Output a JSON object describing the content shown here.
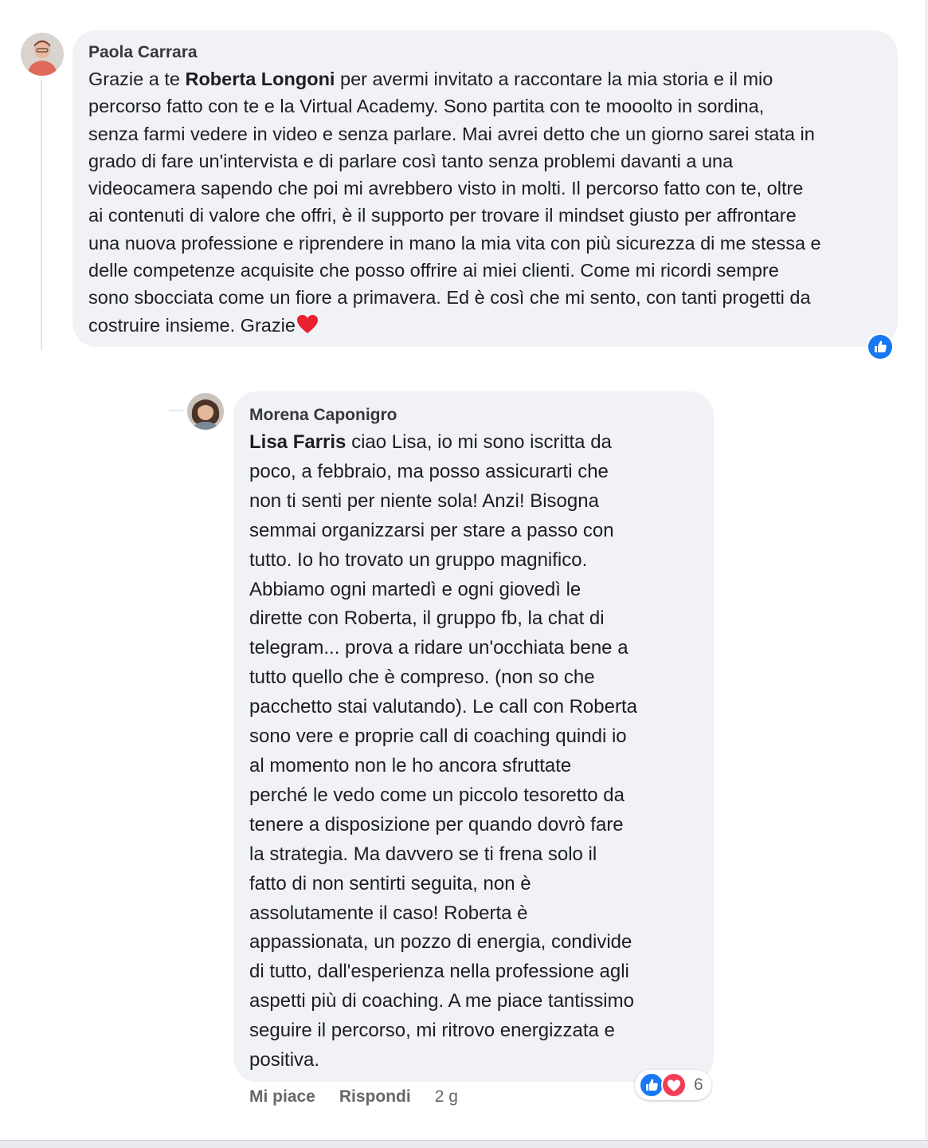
{
  "colors": {
    "bubble_bg": "#f0f2f5",
    "text": "#1c1e21",
    "secondary_text": "#65676b",
    "like_blue": "#1877f2",
    "love_red": "#f33e58"
  },
  "comments": [
    {
      "author": "Paola Carrara",
      "avatar_icon": "profile-photo",
      "lines": [
        {
          "mention": "",
          "text": "Grazie a te "
        },
        {
          "mention": "",
          "text": "percorso fatto con te e la Virtual Academy. Sono partita con te mooolto in sordina,"
        },
        {
          "mention": "",
          "text": "senza farmi vedere in video e senza parlare. Mai avrei detto che un giorno sarei stata in"
        },
        {
          "mention": "",
          "text": "grado di fare un'intervista e di parlare così tanto senza problemi davanti a una"
        },
        {
          "mention": "",
          "text": "videocamera sapendo che poi mi avrebbero visto in molti. Il percorso fatto con te, oltre"
        },
        {
          "mention": "",
          "text": "ai contenuti di valore che offri, è il supporto per trovare il mindset giusto per affrontare"
        },
        {
          "mention": "",
          "text": "una nuova professione e riprendere in mano la mia vita con più sicurezza di me stessa e"
        },
        {
          "mention": "",
          "text": "delle competenze acquisite che posso offrire ai miei clienti. Come mi ricordi sempre"
        },
        {
          "mention": "",
          "text": "sono sbocciata come un fiore a primavera. Ed è così che mi sento, con tanti progetti da"
        },
        {
          "mention": "",
          "text": "costruire insieme. Grazie"
        }
      ],
      "mention": "Roberta Longoni",
      "first_line_rest": " per avermi invitato a raccontare la mia storia e il mio",
      "emoji": "heart",
      "reaction_icon": "like-icon"
    },
    {
      "author": "Morena Caponigro",
      "avatar_icon": "profile-photo",
      "mention": "Lisa Farris",
      "first_line_rest": " ciao Lisa, io mi sono iscritta da",
      "lines": [
        "poco, a febbraio, ma posso assicurarti che",
        "non ti senti per niente sola! Anzi! Bisogna",
        "semmai organizzarsi per stare a passo con",
        "tutto. Io ho trovato un gruppo magnifico.",
        "Abbiamo ogni martedì e ogni giovedì le",
        "dirette con Roberta, il gruppo fb, la chat di",
        "telegram... prova a ridare un'occhiata bene a",
        "tutto quello che è compreso. (non so che",
        "pacchetto stai valutando). Le call con Roberta",
        "sono vere e proprie call di coaching quindi io",
        "al momento non le ho ancora sfruttate",
        "perché le vedo come un piccolo tesoretto da",
        "tenere a disposizione per quando dovrò fare",
        "la strategia. Ma davvero se ti frena solo il",
        "fatto di non sentirti seguita, non è",
        "assolutamente il caso! Roberta è",
        "appassionata, un pozzo di energia, condivide",
        "di tutto, dall'esperienza nella professione agli",
        "aspetti più di coaching. A me piace tantissimo",
        "seguire il percorso, mi ritrovo energizzata e",
        "positiva."
      ],
      "reactions": {
        "icons": [
          "like-icon",
          "love-icon"
        ],
        "count": "6"
      },
      "actions": {
        "like": "Mi piace",
        "reply": "Rispondi",
        "time": "2 g"
      }
    }
  ]
}
